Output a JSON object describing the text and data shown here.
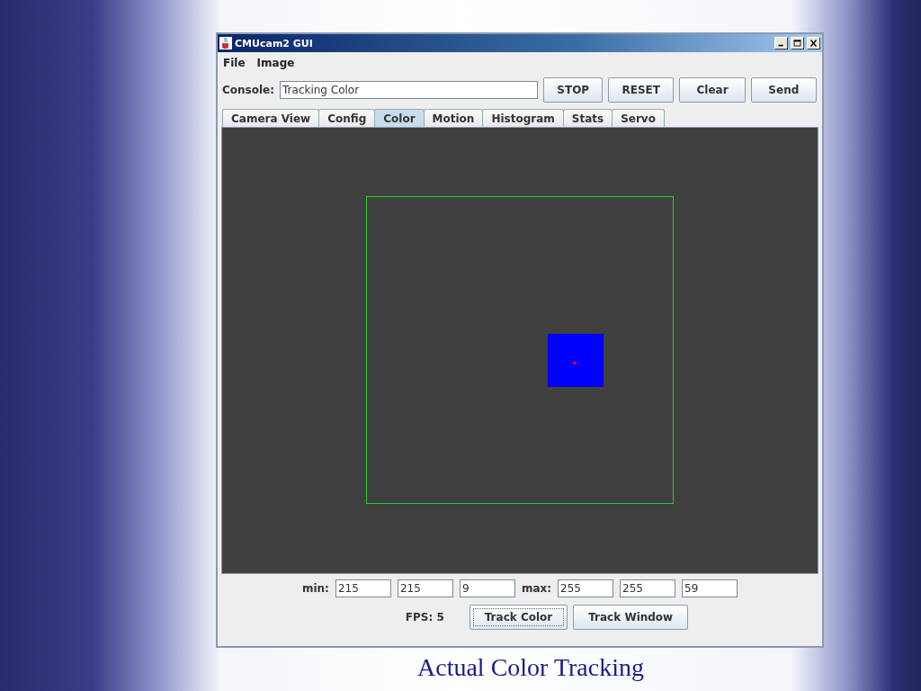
{
  "window": {
    "title": "CMUcam2 GUI"
  },
  "menu": [
    "File",
    "Image"
  ],
  "console": {
    "label": "Console:",
    "value": "Tracking Color"
  },
  "toolbar_buttons": [
    "STOP",
    "RESET",
    "Clear",
    "Send"
  ],
  "tabs": [
    {
      "label": "Camera View",
      "selected": false
    },
    {
      "label": "Config",
      "selected": false
    },
    {
      "label": "Color",
      "selected": true
    },
    {
      "label": "Motion",
      "selected": false
    },
    {
      "label": "Histogram",
      "selected": false
    },
    {
      "label": "Stats",
      "selected": false
    },
    {
      "label": "Servo",
      "selected": false
    }
  ],
  "min": {
    "label": "min:",
    "values": [
      "215",
      "215",
      "9"
    ]
  },
  "max": {
    "label": "max:",
    "values": [
      "255",
      "255",
      "59"
    ]
  },
  "fps": "FPS: 5",
  "track_buttons": [
    {
      "label": "Track Color",
      "focused": true
    },
    {
      "label": "Track Window",
      "focused": false
    }
  ],
  "caption": "Actual Color Tracking"
}
